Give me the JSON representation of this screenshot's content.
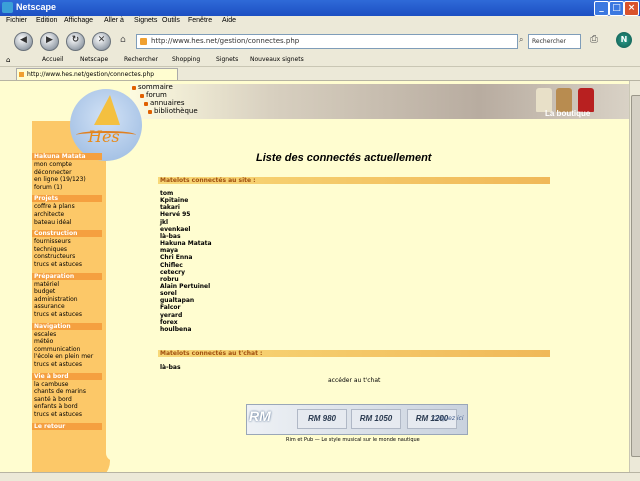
{
  "window": {
    "title": "Netscape",
    "buttons": [
      "_",
      "□",
      "×"
    ]
  },
  "menu": [
    "Fichier",
    "Edition",
    "Affichage",
    "Aller à",
    "Signets",
    "Outils",
    "Fenêtre",
    "Aide"
  ],
  "navbar": {
    "url": "http://www.hes.net/gestion/connectes.php",
    "search_label": "Rechercher"
  },
  "bookmarks": [
    "Accueil",
    "Netscape",
    "Rechercher",
    "Shopping",
    "Signets",
    "Nouveaux signets"
  ],
  "tab": {
    "label": "http://www.hes.net/gestion/connectes.php"
  },
  "header": {
    "top_links": [
      "sommaire",
      "forum",
      "annuaires",
      "bibliothèque"
    ],
    "boutique": "La boutique",
    "logo": "Hes"
  },
  "sidebar": {
    "sections": [
      {
        "title": "Hakuna Matata",
        "items": [
          "mon compte",
          "déconnecter",
          "en ligne (19/123)",
          "forum (1)"
        ]
      },
      {
        "title": "Projets",
        "items": [
          "coffre à plans",
          "architecte",
          "bateau idéal"
        ]
      },
      {
        "title": "Construction",
        "items": [
          "fournisseurs",
          "techniques",
          "constructeurs",
          "trucs et astuces"
        ]
      },
      {
        "title": "Préparation",
        "items": [
          "matériel",
          "budget",
          "administration",
          "assurance",
          "trucs et astuces"
        ]
      },
      {
        "title": "Navigation",
        "items": [
          "escales",
          "météo",
          "communication",
          "l'école en plein mer",
          "trucs et astuces"
        ]
      },
      {
        "title": "Vie à bord",
        "items": [
          "la cambuse",
          "chants de marins",
          "santé à bord",
          "enfants à bord",
          "trucs et astuces"
        ]
      },
      {
        "title": "Le retour",
        "items": []
      }
    ]
  },
  "main": {
    "title": "Liste des connectés actuellement",
    "connected_header": "Matelots connectés au site :",
    "connected": [
      "tom",
      "Kpitaine",
      "takari",
      "Hervé 95",
      "jkl",
      "evenkael",
      "là-bas",
      "Hakuna Matata",
      "maya",
      "Chri Enna",
      "Chiflec",
      "cetecry",
      "robru",
      "Alain Pertuinel",
      "sorel",
      "gualtapan",
      "Falcor",
      "yerard",
      "forex",
      "houlbena"
    ],
    "chat_header": "Matelots connectés au t'chat :",
    "chat": [
      "là-bas"
    ],
    "back_link": "accéder au t'chat"
  },
  "rm_banner": {
    "logo": "RM",
    "stations": [
      "RM 980",
      "RM 1050",
      "RM 1200"
    ],
    "click": "Cliquez ici",
    "subtitle": "Rim et Pub — Le style musical sur le monde nautique"
  }
}
